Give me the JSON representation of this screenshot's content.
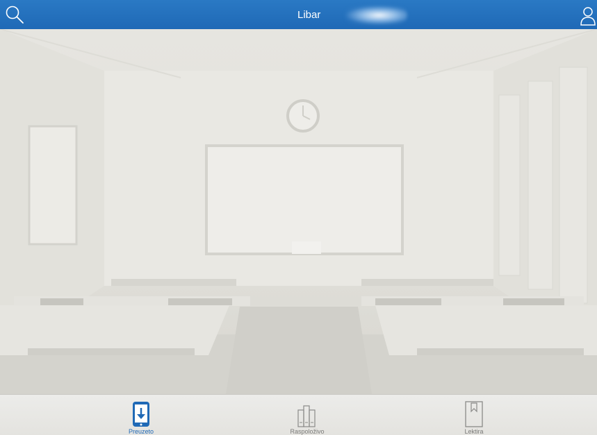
{
  "app": {
    "title": "Libar"
  },
  "icons": {
    "search": "search-icon",
    "user": "user-icon",
    "preuzeto": "phone-download-icon",
    "raspolozivo": "books-icon",
    "lektira": "bookmark-book-icon"
  },
  "colors": {
    "header": "#1f69b6",
    "active_tab": "#1f69b6",
    "inactive_tab": "#7a7a78"
  },
  "tabs": [
    {
      "label": "Preuzeto",
      "active": true
    },
    {
      "label": "Raspoloživo",
      "active": false
    },
    {
      "label": "Lektira",
      "active": false
    }
  ]
}
